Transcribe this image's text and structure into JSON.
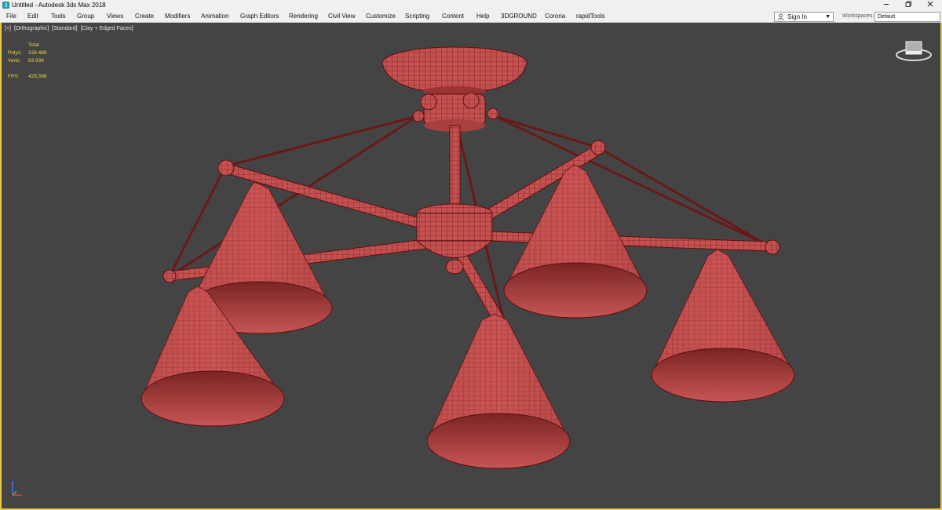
{
  "window": {
    "title": "Untitled - Autodesk 3ds Max 2018",
    "icon": "3dsmax-app-icon",
    "controls": [
      "minimize-icon",
      "restore-icon",
      "close-icon"
    ]
  },
  "menu": {
    "items": [
      "File",
      "Edit",
      "Tools",
      "Group",
      "Views",
      "Create",
      "Modifiers",
      "Animation",
      "Graph Editors",
      "Rendering",
      "Civil View",
      "Customize",
      "Scripting",
      "Content",
      "Help",
      "3DGROUND",
      "Corona",
      "rapidTools"
    ]
  },
  "signin": {
    "label": "Sign In",
    "icon": "user-icon"
  },
  "workspaces": {
    "label": "Workspaces:",
    "value": "Default"
  },
  "viewport": {
    "labels": [
      "[+]",
      "[Orthographic]",
      "[Standard]",
      "[Clay + Edged Faces]"
    ],
    "border_color": "#e8c64a",
    "background_color": "#444444",
    "model_color": "#c85050"
  },
  "stats": {
    "header": "Total",
    "polys_label": "Polys:",
    "polys_value": "126 488",
    "verts_label": "Verts:",
    "verts_value": "63 938",
    "fps_label": "FPS:",
    "fps_value": "428,596"
  },
  "viewcube": {
    "icon": "viewcube-icon"
  },
  "axis_tripod": {
    "icon": "axis-tripod-icon"
  }
}
